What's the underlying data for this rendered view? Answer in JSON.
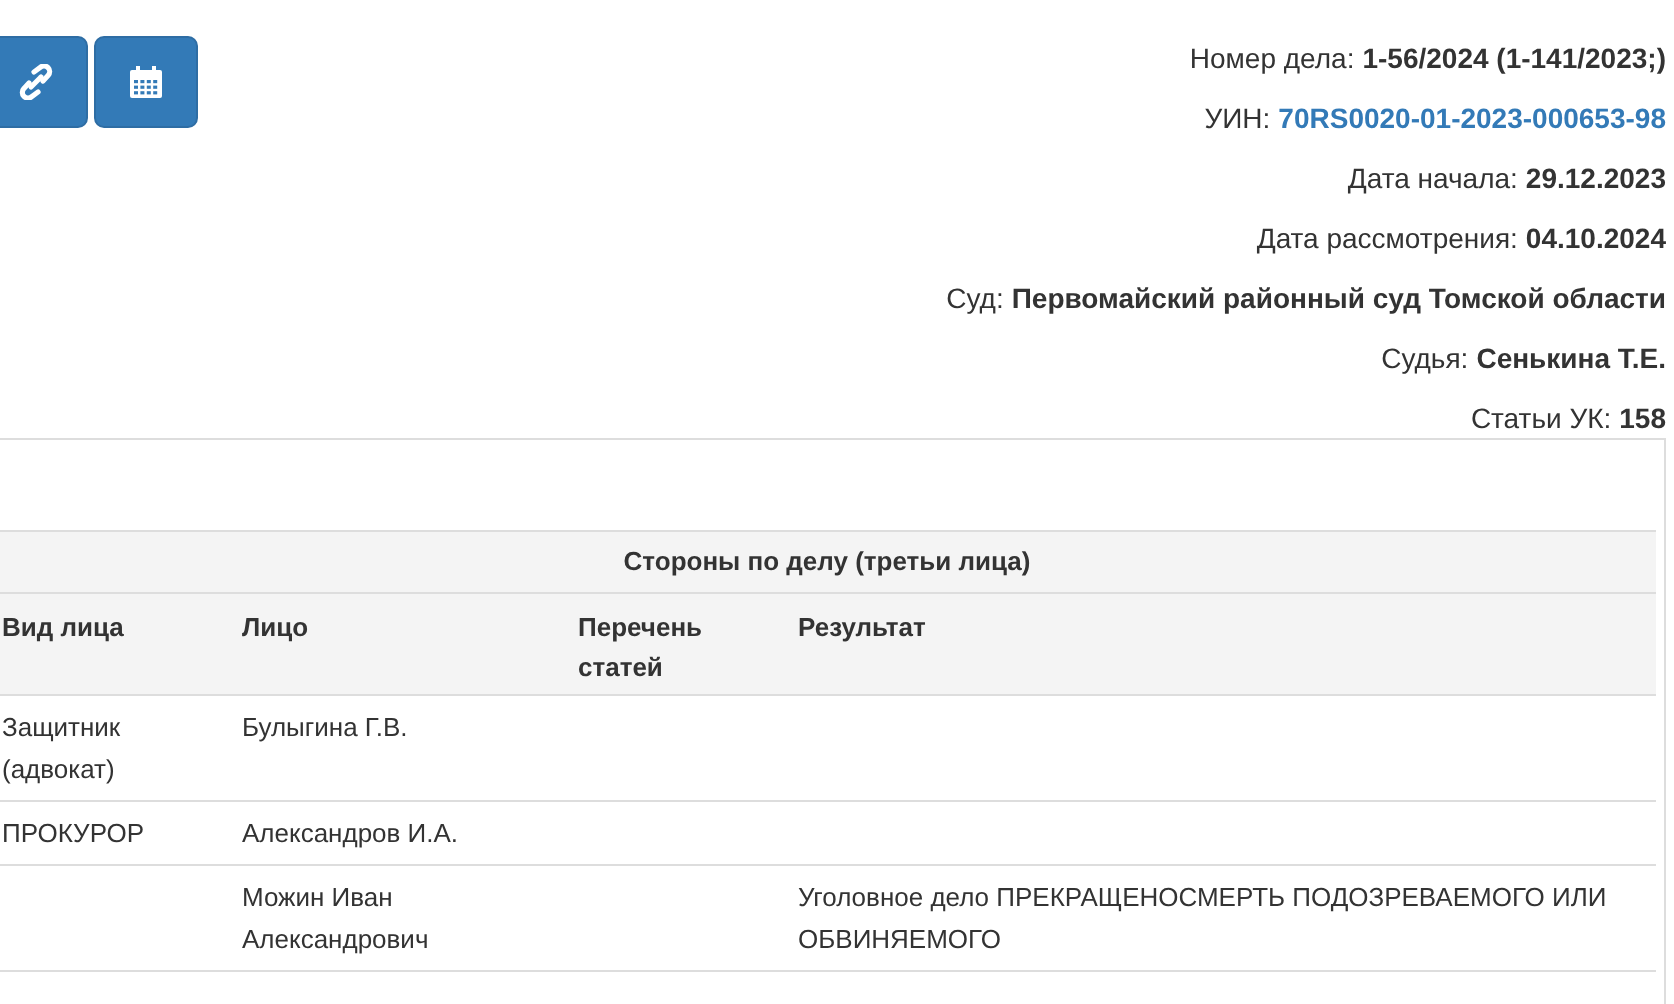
{
  "toolbar": [
    {
      "kind": "link"
    },
    {
      "kind": "calendar"
    }
  ],
  "case_info": [
    {
      "label": "Номер дела:",
      "value": "1-56/2024 (1-141/2023;)",
      "kind": "text"
    },
    {
      "label": "УИН:",
      "value": "70RS0020-01-2023-000653-98",
      "kind": "link"
    },
    {
      "label": "Дата начала:",
      "value": "29.12.2023",
      "kind": "text"
    },
    {
      "label": "Дата рассмотрения:",
      "value": "04.10.2024",
      "kind": "text"
    },
    {
      "label": "Суд:",
      "value": "Первомайский районный суд Томской области",
      "kind": "text"
    },
    {
      "label": "Судья:",
      "value": "Сенькина Т.Е.",
      "kind": "text"
    },
    {
      "label": "Статьи УК:",
      "value": "158",
      "kind": "text"
    }
  ],
  "table": {
    "title": "Стороны по делу (третьи лица)",
    "columns": [
      "Вид лица",
      "Лицо",
      "Перечень статей",
      "Результат"
    ],
    "rows": [
      [
        "Защитник (адвокат)",
        "Булыгина Г.В.",
        "",
        ""
      ],
      [
        "ПРОКУРОР",
        "Александров И.А.",
        "",
        ""
      ],
      [
        "",
        "Можин Иван Александрович",
        "",
        "Уголовное дело ПРЕКРАЩЕНОСМЕРТЬ ПОДОЗРЕВАЕМОГО ИЛИ ОБВИНЯЕМОГО"
      ]
    ]
  }
}
